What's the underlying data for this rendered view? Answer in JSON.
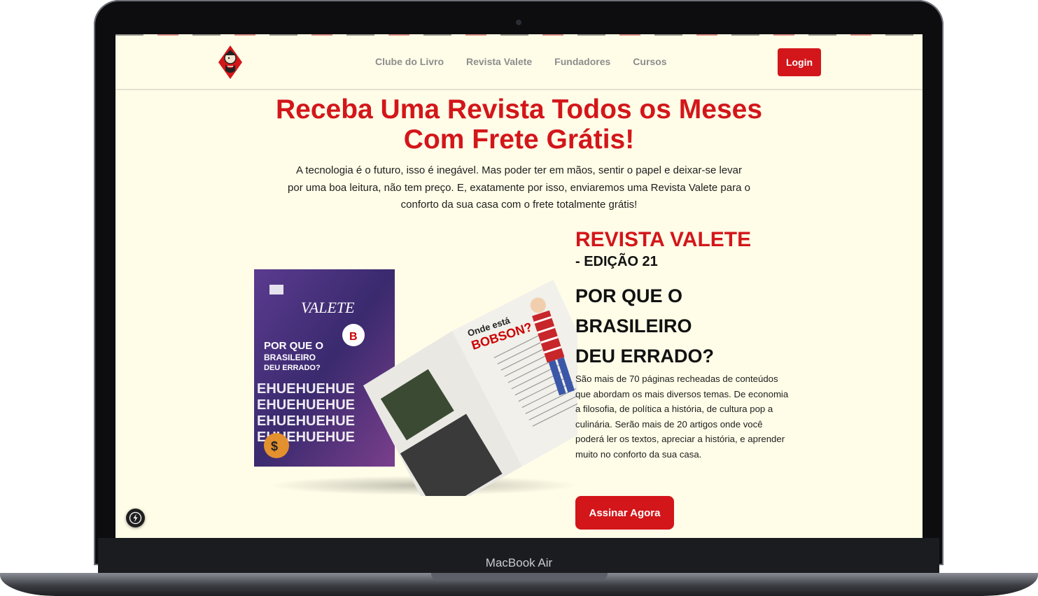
{
  "device": {
    "brand_label": "MacBook Air"
  },
  "nav": {
    "items": [
      "Clube do Livro",
      "Revista Valete",
      "Fundadores",
      "Cursos"
    ],
    "login_label": "Login"
  },
  "hero": {
    "title_line1": "Receba Uma Revista Todos os Meses",
    "title_line2": "Com Frete Grátis!",
    "text_line1": "A tecnologia é o futuro, isso é inegável. Mas poder ter em mãos, sentir o papel e deixar-se levar",
    "text_line2": "por uma boa leitura, não tem preço. E, exatamente por isso, enviaremos uma Revista Valete para o",
    "text_line3": "conforto da sua casa com o frete totalmente grátis!"
  },
  "magazine": {
    "brand": "VALETE",
    "cover_headline_1": "POR QUE O",
    "cover_headline_2": "BRASILEIRO",
    "cover_headline_3": "DEU ERRADO?",
    "cover_pattern": "EHUEHUEHUE",
    "spread_headline_1": "Onde está",
    "spread_headline_2": "BOBSON?"
  },
  "product": {
    "title": "REVISTA VALETE",
    "edition": "- EDIÇÃO 21",
    "headline_1": "POR QUE O",
    "headline_2": "BRASILEIRO",
    "headline_3": "DEU ERRADO?",
    "body_lines": [
      "São mais de 70 páginas recheadas de conteúdos",
      "que abordam os mais diversos temas. De economia",
      "a filosofia, de política a história, de cultura pop a",
      "culinária. Serão mais de 20 artigos onde você",
      "poderá ler os textos, apreciar a história, e aprender",
      "muito no conforto da sua casa."
    ],
    "cta_label": "Assinar Agora"
  },
  "colors": {
    "accent": "#d3161a",
    "background": "#fffde8",
    "nav_text": "#8d8d8d"
  },
  "icons": {
    "logo": "valete-card-logo",
    "fab": "lightning-icon"
  }
}
